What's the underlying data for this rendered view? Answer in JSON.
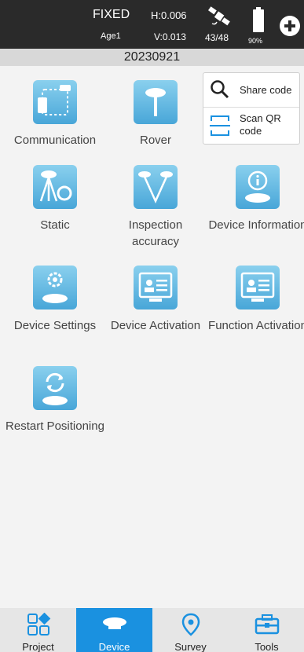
{
  "status": {
    "fix": "FIXED",
    "age": "Age1",
    "h_precision": "H:0.006",
    "v_precision": "V:0.013",
    "satellites": "43/48",
    "battery": "90%"
  },
  "date_header": "20230921",
  "tiles": [
    {
      "label": "Communication",
      "icon": "communication-icon"
    },
    {
      "label": "Rover",
      "icon": "rover-icon"
    },
    {
      "label": "Static",
      "icon": "static-icon"
    },
    {
      "label": "Inspection accuracy",
      "icon": "inspection-icon"
    },
    {
      "label": "Device Information",
      "icon": "device-info-icon"
    },
    {
      "label": "Device Settings",
      "icon": "device-settings-icon"
    },
    {
      "label": "Device Activation",
      "icon": "device-activation-icon"
    },
    {
      "label": "Function Activation",
      "icon": "function-activation-icon"
    },
    {
      "label": "Restart Positioning",
      "icon": "restart-icon"
    }
  ],
  "popup": {
    "share_code": "Share code",
    "scan_qr": "Scan QR code"
  },
  "nav": [
    {
      "label": "Project",
      "icon": "project-icon"
    },
    {
      "label": "Device",
      "icon": "device-icon",
      "active": true
    },
    {
      "label": "Survey",
      "icon": "survey-pin-icon"
    },
    {
      "label": "Tools",
      "icon": "tools-icon"
    }
  ],
  "colors": {
    "status_bg": "#2a2a2a",
    "accent": "#1a91e0",
    "tile_gradient_top": "#8ad0ee",
    "tile_gradient_bottom": "#48a6d8"
  }
}
